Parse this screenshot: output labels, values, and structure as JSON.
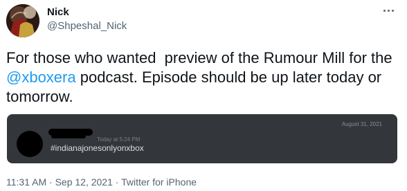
{
  "user": {
    "name": "Nick",
    "handle": "@Shpeshal_Nick",
    "avatar_icon": "profile-avatar"
  },
  "more_icon": "more-horizontal-icon",
  "tweet": {
    "text_before": "For those who wanted  preview of the Rumour Mill for the ",
    "mention": "@xboxera",
    "text_after": " podcast. Episode should be up later today or tomorrow."
  },
  "embedded_screenshot": {
    "date": "August 31, 2021",
    "time": "Today at 5:24 PM",
    "message": "#indianajonesonlyonxbox",
    "background": "#33363b"
  },
  "meta": {
    "time": "11:31 AM",
    "sep1": " · ",
    "date": "Sep 12, 2021",
    "sep2": " · ",
    "source": "Twitter for iPhone"
  },
  "colors": {
    "text": "#0f1419",
    "secondary": "#536471",
    "link": "#1d9bf0"
  }
}
